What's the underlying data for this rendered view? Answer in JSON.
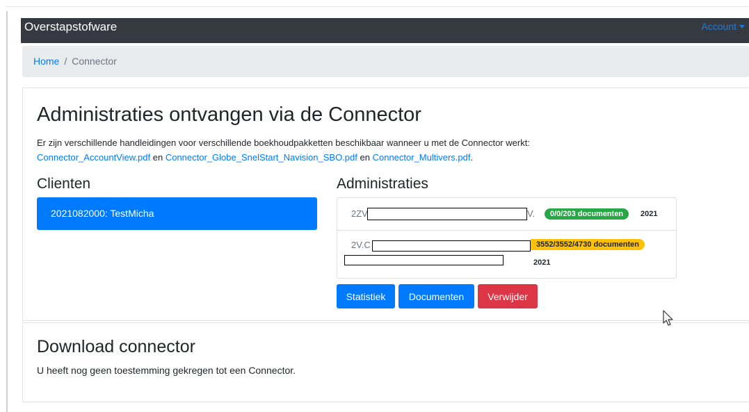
{
  "navbar": {
    "brand": "Overstapstofware",
    "account_label": "Account"
  },
  "breadcrumb": {
    "home": "Home",
    "separator": "/",
    "current": "Connector"
  },
  "main": {
    "title": "Administraties ontvangen via de Connector",
    "intro_text": "Er zijn verschillende handleidingen voor verschillende boekhoudpakketten beschikbaar wanneer u met de Connector werkt:",
    "links": [
      "Connector_AccountView.pdf",
      "Connector_Globe_SnelStart_Navision_SBO.pdf",
      "Connector_Multivers.pdf"
    ],
    "link_joiner": "en",
    "end_punct": "."
  },
  "clients": {
    "title": "Clienten",
    "items": [
      {
        "label": "2021082000: TestMicha",
        "active": true
      }
    ]
  },
  "administraties": {
    "title": "Administraties",
    "items": [
      {
        "name_prefix": "2ZV",
        "name_suffix": "V.",
        "badge": "0/0/203 documenten",
        "badge_color": "#28a745",
        "year": "2021"
      },
      {
        "name_prefix": "2V.C",
        "badge": "3552/3552/4730 documenten",
        "badge_color": "#ffc107",
        "year": "2021"
      }
    ]
  },
  "actions": {
    "statistiek": "Statistiek",
    "documenten": "Documenten",
    "verwijder": "Verwijder"
  },
  "download": {
    "title": "Download connector",
    "text": "U heeft nog geen toestemming gekregen tot een Connector."
  },
  "colors": {
    "navbar": "#343a40",
    "primary": "#007bff",
    "danger": "#dc3545",
    "success": "#28a745",
    "warning": "#ffc107"
  },
  "icons": {
    "account_caret": "chevron-down-icon",
    "pointer": "mouse-cursor-icon"
  }
}
